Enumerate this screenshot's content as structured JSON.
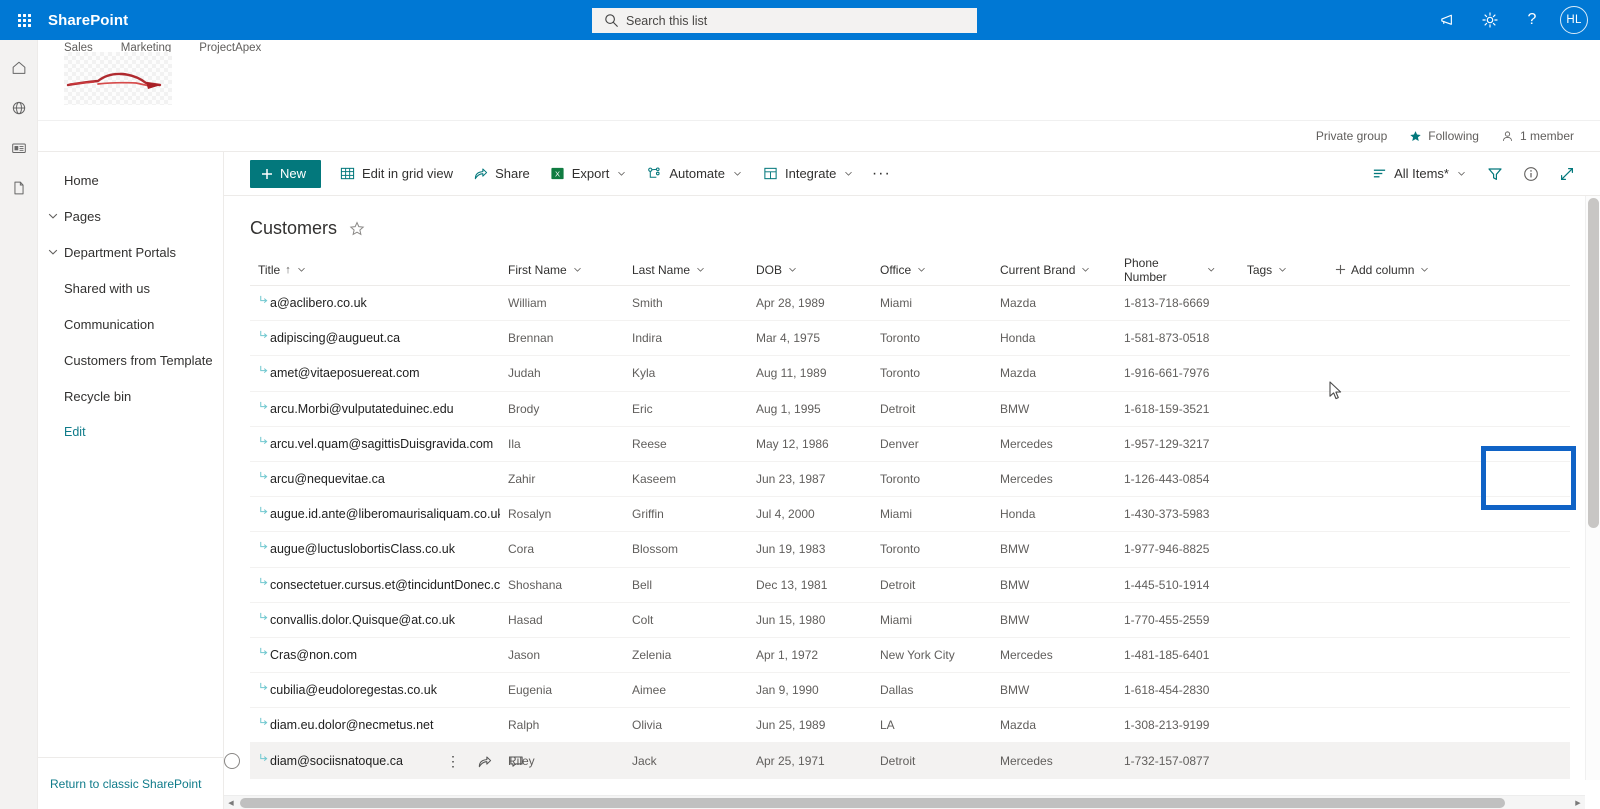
{
  "suite": {
    "brand": "SharePoint",
    "search_placeholder": "Search this list",
    "search_value": "",
    "icons": {
      "waffle": "waffle-icon",
      "search": "search-icon",
      "feedback": "megaphone-icon",
      "settings": "gear-icon",
      "help": "help-icon"
    },
    "avatar_initials": "HL"
  },
  "rail": {
    "items": [
      {
        "name": "home",
        "label": "Home"
      },
      {
        "name": "globe",
        "label": "My sites"
      },
      {
        "name": "news",
        "label": "News"
      },
      {
        "name": "files",
        "label": "Files"
      }
    ]
  },
  "site": {
    "nav": [
      "Sales",
      "Marketing",
      "ProjectApex"
    ],
    "logo_alt": "car-logo"
  },
  "group_bar": {
    "privacy": "Private group",
    "following": "Following",
    "members": "1 member"
  },
  "leftnav": {
    "items": [
      {
        "label": "Home",
        "expandable": false
      },
      {
        "label": "Pages",
        "expandable": true
      },
      {
        "label": "Department Portals",
        "expandable": true
      },
      {
        "label": "Shared with us",
        "expandable": false
      },
      {
        "label": "Communication",
        "expandable": false
      },
      {
        "label": "Customers from Template",
        "expandable": false
      }
    ],
    "recycle_bin": "Recycle bin",
    "edit": "Edit",
    "classic_link": "Return to classic SharePoint"
  },
  "commandbar": {
    "new_label": "New",
    "edit_grid_label": "Edit in grid view",
    "share_label": "Share",
    "export_label": "Export",
    "automate_label": "Automate",
    "integrate_label": "Integrate",
    "overflow_label": "···",
    "view_label": "All Items*",
    "filter_icon": "filter-icon",
    "info_icon": "info-icon",
    "expand_icon": "expand-icon"
  },
  "list": {
    "title": "Customers",
    "favorite_icon": "star-outline-icon",
    "columns": [
      {
        "key": "title",
        "label": "Title",
        "sorted": "asc"
      },
      {
        "key": "first",
        "label": "First Name",
        "sorted": ""
      },
      {
        "key": "last",
        "label": "Last Name",
        "sorted": ""
      },
      {
        "key": "dob",
        "label": "DOB",
        "sorted": ""
      },
      {
        "key": "office",
        "label": "Office",
        "sorted": ""
      },
      {
        "key": "brand",
        "label": "Current Brand",
        "sorted": ""
      },
      {
        "key": "phone",
        "label": "Phone Number",
        "sorted": ""
      },
      {
        "key": "tags",
        "label": "Tags",
        "sorted": ""
      }
    ],
    "add_column_label": "Add column",
    "sort_asc_glyph": "↑",
    "rows": [
      {
        "title": "a@aclibero.co.uk",
        "first": "William",
        "last": "Smith",
        "dob": "Apr 28, 1989",
        "office": "Miami",
        "brand": "Mazda",
        "phone": "1-813-718-6669",
        "tags": ""
      },
      {
        "title": "adipiscing@augueut.ca",
        "first": "Brennan",
        "last": "Indira",
        "dob": "Mar 4, 1975",
        "office": "Toronto",
        "brand": "Honda",
        "phone": "1-581-873-0518",
        "tags": ""
      },
      {
        "title": "amet@vitaeposuereat.com",
        "first": "Judah",
        "last": "Kyla",
        "dob": "Aug 11, 1989",
        "office": "Toronto",
        "brand": "Mazda",
        "phone": "1-916-661-7976",
        "tags": ""
      },
      {
        "title": "arcu.Morbi@vulputateduinec.edu",
        "first": "Brody",
        "last": "Eric",
        "dob": "Aug 1, 1995",
        "office": "Detroit",
        "brand": "BMW",
        "phone": "1-618-159-3521",
        "tags": ""
      },
      {
        "title": "arcu.vel.quam@sagittisDuisgravida.com",
        "first": "Ila",
        "last": "Reese",
        "dob": "May 12, 1986",
        "office": "Denver",
        "brand": "Mercedes",
        "phone": "1-957-129-3217",
        "tags": ""
      },
      {
        "title": "arcu@nequevitae.ca",
        "first": "Zahir",
        "last": "Kaseem",
        "dob": "Jun 23, 1987",
        "office": "Toronto",
        "brand": "Mercedes",
        "phone": "1-126-443-0854",
        "tags": ""
      },
      {
        "title": "augue.id.ante@liberomaurisaliquam.co.uk",
        "first": "Rosalyn",
        "last": "Griffin",
        "dob": "Jul 4, 2000",
        "office": "Miami",
        "brand": "Honda",
        "phone": "1-430-373-5983",
        "tags": ""
      },
      {
        "title": "augue@luctuslobortisClass.co.uk",
        "first": "Cora",
        "last": "Blossom",
        "dob": "Jun 19, 1983",
        "office": "Toronto",
        "brand": "BMW",
        "phone": "1-977-946-8825",
        "tags": ""
      },
      {
        "title": "consectetuer.cursus.et@tinciduntDonec.co.uk",
        "first": "Shoshana",
        "last": "Bell",
        "dob": "Dec 13, 1981",
        "office": "Detroit",
        "brand": "BMW",
        "phone": "1-445-510-1914",
        "tags": ""
      },
      {
        "title": "convallis.dolor.Quisque@at.co.uk",
        "first": "Hasad",
        "last": "Colt",
        "dob": "Jun 15, 1980",
        "office": "Miami",
        "brand": "BMW",
        "phone": "1-770-455-2559",
        "tags": ""
      },
      {
        "title": "Cras@non.com",
        "first": "Jason",
        "last": "Zelenia",
        "dob": "Apr 1, 1972",
        "office": "New York City",
        "brand": "Mercedes",
        "phone": "1-481-185-6401",
        "tags": ""
      },
      {
        "title": "cubilia@eudoloregestas.co.uk",
        "first": "Eugenia",
        "last": "Aimee",
        "dob": "Jan 9, 1990",
        "office": "Dallas",
        "brand": "BMW",
        "phone": "1-618-454-2830",
        "tags": ""
      },
      {
        "title": "diam.eu.dolor@necmetus.net",
        "first": "Ralph",
        "last": "Olivia",
        "dob": "Jun 25, 1989",
        "office": "LA",
        "brand": "Mazda",
        "phone": "1-308-213-9199",
        "tags": ""
      },
      {
        "title": "diam@sociisnatoque.ca",
        "first": "Riley",
        "last": "Jack",
        "dob": "Apr 25, 1971",
        "office": "Detroit",
        "brand": "Mercedes",
        "phone": "1-732-157-0877",
        "tags": "",
        "hovered": true
      }
    ]
  },
  "colors": {
    "suite_blue": "#0078d4",
    "accent_teal": "#03787c",
    "highlight_blue": "#1063c6",
    "link_teal": "#0f7b8a"
  }
}
